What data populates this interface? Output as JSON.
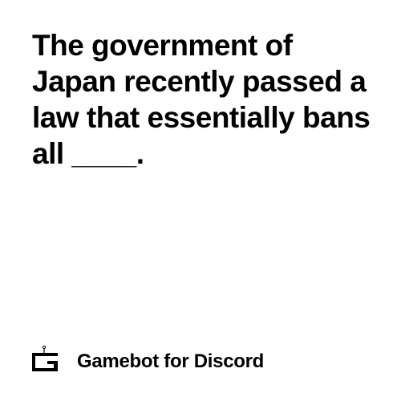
{
  "card": {
    "prompt_text": "The government of Japan recently passed a law that essentially bans all ____.",
    "footer": {
      "logo_icon": "gamebot-logo-icon",
      "brand_text": "Gamebot for Discord"
    }
  },
  "colors": {
    "background": "#ffffff",
    "text": "#000000"
  }
}
